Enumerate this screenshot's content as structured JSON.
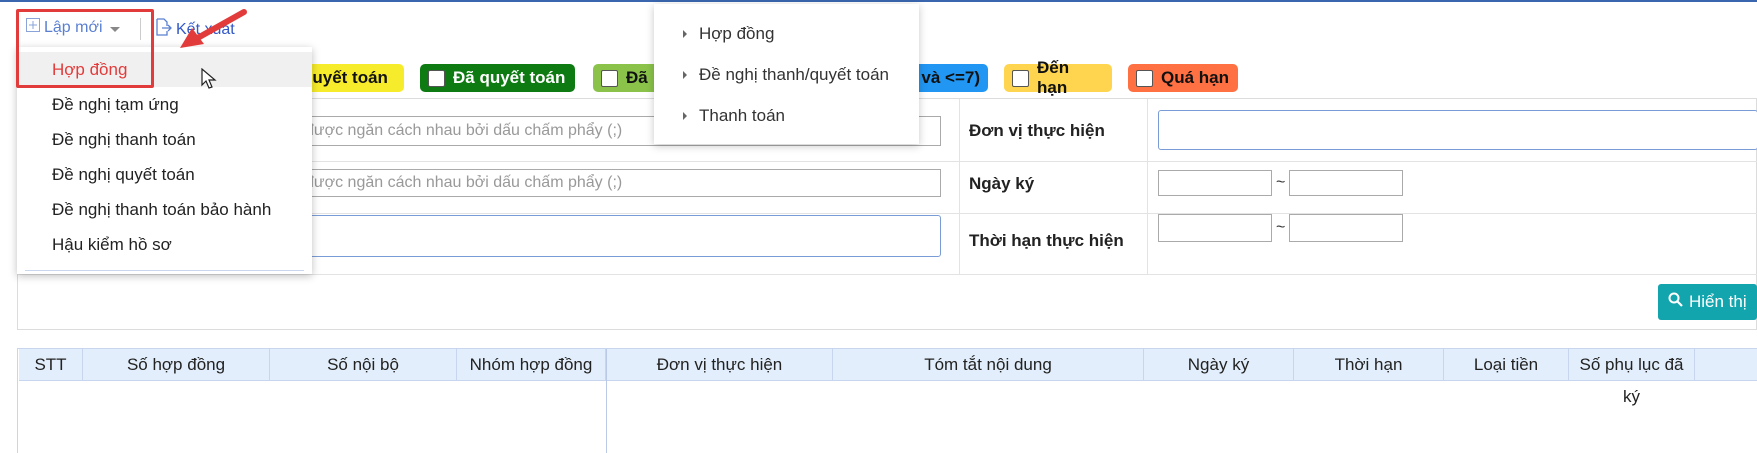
{
  "toolbar": {
    "new_label": "Lập mới",
    "export_label": "Kết xuất"
  },
  "new_menu": {
    "items": [
      {
        "label": "Hợp đồng",
        "active": true
      },
      {
        "label": "Đề nghị tạm ứng"
      },
      {
        "label": "Đề nghị thanh toán"
      },
      {
        "label": "Đề nghị quyết toán"
      },
      {
        "label": "Đề nghị thanh toán bảo hành"
      },
      {
        "label": "Hậu kiểm hồ sơ"
      }
    ]
  },
  "sub_menu": {
    "items": [
      "Hợp đồng",
      "Đề nghị thanh/quyết toán",
      "Thanh toán"
    ]
  },
  "status_chips": [
    {
      "label": "quyết toán",
      "color": "#f7ec2b",
      "text_color": "#111"
    },
    {
      "label": "Đã quyết toán",
      "color": "#0d7a12",
      "text_color": "#ffffff"
    },
    {
      "label": "Đã",
      "color": "#8bc34a",
      "text_color": "#111"
    },
    {
      "label": "và <=7)",
      "color": "#2196f3",
      "text_color": "#111"
    },
    {
      "label": "Đến hạn",
      "color": "#ffd54f",
      "text_color": "#111"
    },
    {
      "label": "Quá hạn",
      "color": "#ff7043",
      "text_color": "#111"
    }
  ],
  "form": {
    "placeholder_1": "được ngăn cách nhau bởi dấu chấm phẩy (;)",
    "placeholder_2": "được ngăn cách nhau bởi dấu chấm phẩy (;)",
    "don_vi_label": "Đơn vị thực hiện",
    "ngay_ky_label": "Ngày ký",
    "thoi_han_label": "Thời hạn thực hiện",
    "tilde": "~",
    "show_button": "Hiển thị"
  },
  "table": {
    "columns": [
      "STT",
      "Số hợp đồng",
      "Số nội bộ",
      "Nhóm hợp đồng",
      "Đơn vị thực hiện",
      "Tóm tắt nội dung",
      "Ngày ký",
      "Thời hạn",
      "Loại tiền",
      "Số phụ lục đã ký"
    ]
  },
  "colors": {
    "accent": "#5a7fd1",
    "highlight": "#e23b3b",
    "show_button": "#12a5ad",
    "table_header": "#e2eefb"
  }
}
